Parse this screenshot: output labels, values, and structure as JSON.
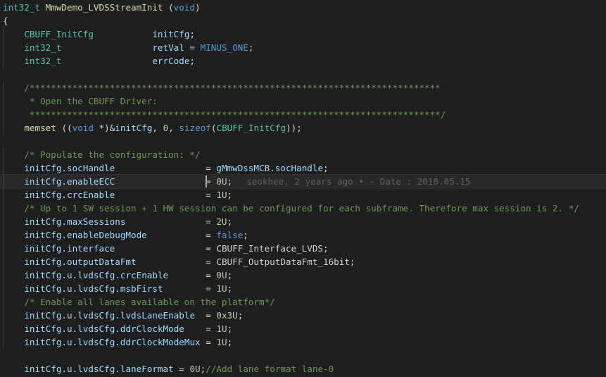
{
  "editor": {
    "lines": [
      {
        "code": "int32_t MmwDemo_LVDSStreamInit (void)"
      },
      {
        "code": "{"
      },
      {
        "code": "    CBUFF_InitCfg           initCfg;"
      },
      {
        "code": "    int32_t                 retVal = MINUS_ONE;"
      },
      {
        "code": "    int32_t                 errCode;"
      },
      {
        "code": ""
      },
      {
        "code": "    /*****************************************************************************"
      },
      {
        "code": "     * Open the CBUFF Driver:"
      },
      {
        "code": "     *****************************************************************************/"
      },
      {
        "code": "    memset ((void *)&initCfg, 0, sizeof(CBUFF_InitCfg));"
      },
      {
        "code": ""
      },
      {
        "code": "    /* Populate the configuration: */"
      },
      {
        "code": "    initCfg.socHandle                 = gMmwDssMCB.socHandle;"
      },
      {
        "code": "    initCfg.enableECC                 = 0U;"
      },
      {
        "code": "    initCfg.crcEnable                 = 1U;"
      },
      {
        "code": "    /* Up to 1 SW session + 1 HW session can be configured for each subframe. Therefore max session is 2. */"
      },
      {
        "code": "    initCfg.maxSessions               = 2U;"
      },
      {
        "code": "    initCfg.enableDebugMode           = false;"
      },
      {
        "code": "    initCfg.interface                 = CBUFF_Interface_LVDS;"
      },
      {
        "code": "    initCfg.outputDataFmt             = CBUFF_OutputDataFmt_16bit;"
      },
      {
        "code": "    initCfg.u.lvdsCfg.crcEnable       = 0U;"
      },
      {
        "code": "    initCfg.u.lvdsCfg.msbFirst        = 1U;"
      },
      {
        "code": "    /* Enable all lanes available on the platform*/"
      },
      {
        "code": "    initCfg.u.lvdsCfg.lvdsLaneEnable  = 0x3U;"
      },
      {
        "code": "    initCfg.u.lvdsCfg.ddrClockMode    = 1U;"
      },
      {
        "code": "    initCfg.u.lvdsCfg.ddrClockModeMux = 1U;"
      },
      {
        "code": ""
      },
      {
        "code": "    initCfg.u.lvdsCfg.laneFormat = 0U;//Add lane format lane-0"
      }
    ],
    "blame": "seokhee, 2 years ago • - Date : 2018.05.15"
  },
  "theme": {
    "background": "#1e1e1e",
    "type": "#4ec9b0",
    "function": "#dcdcaa",
    "keyword": "#569cd6",
    "variable": "#9cdcfe",
    "number": "#b5cea8",
    "comment": "#6a9955",
    "blame": "#5f5f5f"
  }
}
